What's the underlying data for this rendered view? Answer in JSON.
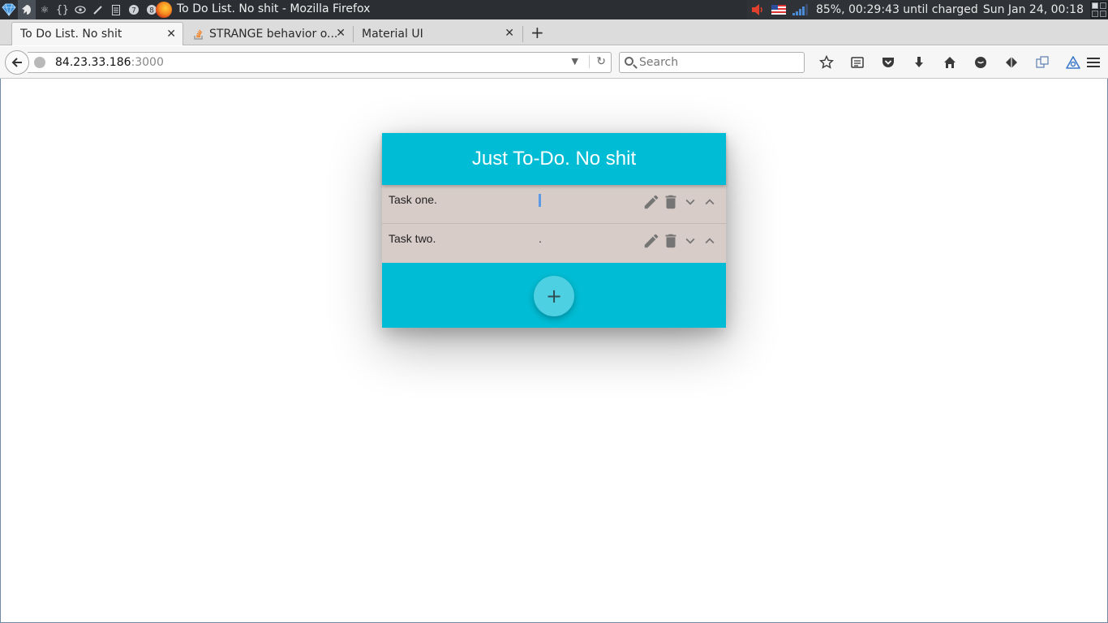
{
  "system_bar": {
    "window_title": "To Do List. No shit - Mozilla Firefox",
    "status": "85%, 00:29:43 until charged",
    "datetime": "Sun Jan 24, 00:18",
    "launcher_icons": [
      "diamond-icon",
      "atom-icon",
      "react-icon",
      "braces-icon",
      "eye-icon",
      "brush-icon",
      "document-icon",
      "circle-7-icon",
      "circle-8-icon"
    ]
  },
  "browser": {
    "tabs": [
      {
        "label": "To Do List. No shit",
        "active": true
      },
      {
        "label": "STRANGE behavior o...",
        "active": false
      },
      {
        "label": "Material UI",
        "active": false
      }
    ],
    "address": {
      "host": "84.23.33.186",
      "port": ":3000"
    },
    "search_placeholder": "Search"
  },
  "app": {
    "title": "Just To-Do. No shit",
    "tasks": [
      {
        "text": "Task one.",
        "marker": ""
      },
      {
        "text": "Task two.",
        "marker": "."
      }
    ],
    "add_label": "+",
    "colors": {
      "primary": "#00bcd4",
      "fab": "#4dd0e1",
      "list_bg": "#d7ccc8",
      "icon": "#757575"
    }
  }
}
